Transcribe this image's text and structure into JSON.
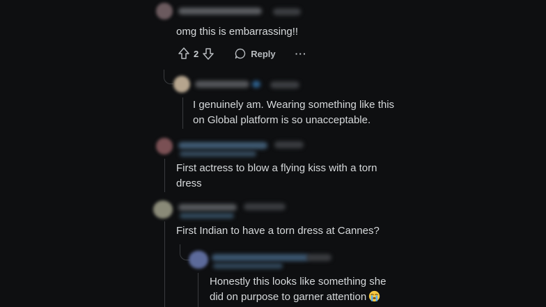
{
  "comments": [
    {
      "text": "omg this is embarrassing!!"
    },
    {
      "text": "I genuinely am. Wearing something like this on Global platform is so unacceptable."
    },
    {
      "text": "First actress to blow a flying kiss with a torn dress"
    },
    {
      "text": "First Indian to have a torn dress at Cannes?"
    },
    {
      "text": "Honestly this looks like something she did on purpose to garner attention"
    }
  ],
  "actions": {
    "score": "2",
    "reply_label": "Reply",
    "more_label": "···"
  },
  "icons": {
    "upvote": "upvote-arrow-icon",
    "downvote": "downvote-arrow-icon",
    "reply": "speech-bubble-icon",
    "more": "ellipsis-icon",
    "emoji": "loudly-crying-face-emoji"
  },
  "colors": {
    "background": "#0e0f11",
    "text": "#d7dadc",
    "meta": "#b8bcc0",
    "thread_line": "#3a3c3f"
  }
}
